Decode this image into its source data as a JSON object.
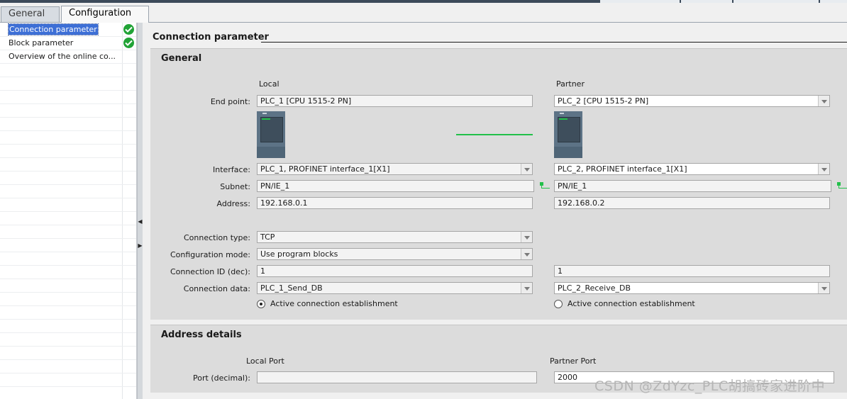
{
  "tabs": {
    "general": "General",
    "configuration": "Configuration"
  },
  "nav": {
    "items": [
      {
        "label": "Connection parameter",
        "selected": true,
        "status": "check-icon"
      },
      {
        "label": "Block parameter",
        "selected": false,
        "status": "check-icon"
      },
      {
        "label": "Overview of the online co...",
        "selected": false,
        "status": ""
      }
    ]
  },
  "page": {
    "title": "Connection parameter"
  },
  "general": {
    "title": "General",
    "local_header": "Local",
    "partner_header": "Partner",
    "labels": {
      "end_point": "End point:",
      "interface": "Interface:",
      "subnet": "Subnet:",
      "address": "Address:",
      "connection_type": "Connection type:",
      "configuration_mode": "Configuration mode:",
      "connection_id": "Connection ID (dec):",
      "connection_data": "Connection data:"
    },
    "local": {
      "end_point": "PLC_1 [CPU 1515-2 PN]",
      "interface": "PLC_1, PROFINET interface_1[X1]",
      "subnet": "PN/IE_1",
      "address": "192.168.0.1",
      "connection_type": "TCP",
      "configuration_mode": "Use program blocks",
      "connection_id": "1",
      "connection_data": "PLC_1_Send_DB",
      "active_establishment": "Active connection establishment",
      "active_selected": true
    },
    "partner": {
      "end_point": "PLC_2 [CPU 1515-2 PN]",
      "interface": "PLC_2, PROFINET interface_1[X1]",
      "subnet": "PN/IE_1",
      "address": "192.168.0.2",
      "connection_id": "1",
      "connection_data": "PLC_2_Receive_DB",
      "active_establishment": "Active connection establishment",
      "active_selected": false
    }
  },
  "address_details": {
    "title": "Address details",
    "local_port_header": "Local Port",
    "partner_port_header": "Partner Port",
    "port_label": "Port (decimal):",
    "local_port": "",
    "partner_port": "2000"
  },
  "watermark": "CSDN @ZdYzc_PLC胡搞砖家进阶中",
  "colors": {
    "accent": "#3d6fd6",
    "ok": "#21a336",
    "link": "#22c04a",
    "panel": "#dcdcdc"
  }
}
